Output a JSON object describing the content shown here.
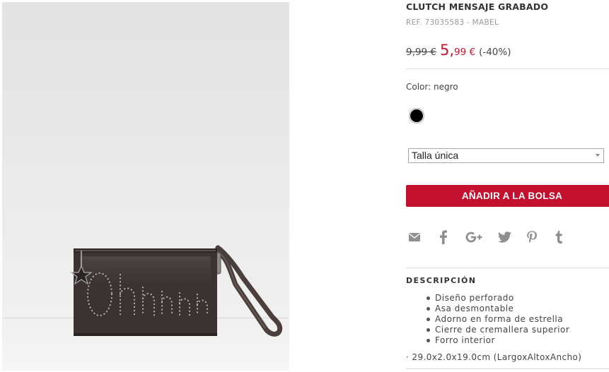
{
  "product": {
    "title": "CLUTCH MENSAJE GRABADO",
    "ref": "REF. 73035583 - MABEL",
    "image": {
      "alt": "Clutch negro con mensaje perforado",
      "engraving": "Ohhhhh"
    }
  },
  "price": {
    "old": "9,99 €",
    "new_int": "5,",
    "new_dec": "99 €",
    "discount": "(-40%)"
  },
  "color": {
    "label": "Color: negro",
    "swatch_hex": "#000000"
  },
  "size": {
    "selected": "Talla única"
  },
  "cart": {
    "add_label": "AÑADIR A LA BOLSA"
  },
  "share": {
    "icons": [
      "email-icon",
      "facebook-icon",
      "google-plus-icon",
      "twitter-icon",
      "pinterest-icon",
      "tumblr-icon"
    ],
    "icon_color": "#8f8f8f"
  },
  "description": {
    "title": "DESCRIPCIÓN",
    "features": [
      "Diseño perforado",
      "Asa desmontable",
      "Adorno en forma de estrella",
      "Cierre de cremallera superior",
      "Forro interior"
    ],
    "dimensions": "· 29.0x2.0x19.0cm (LargoxAltoxAncho)"
  },
  "colors": {
    "accent": "#c4102f",
    "sale_price": "#c4122f",
    "muted_text": "#9a9a9a"
  }
}
